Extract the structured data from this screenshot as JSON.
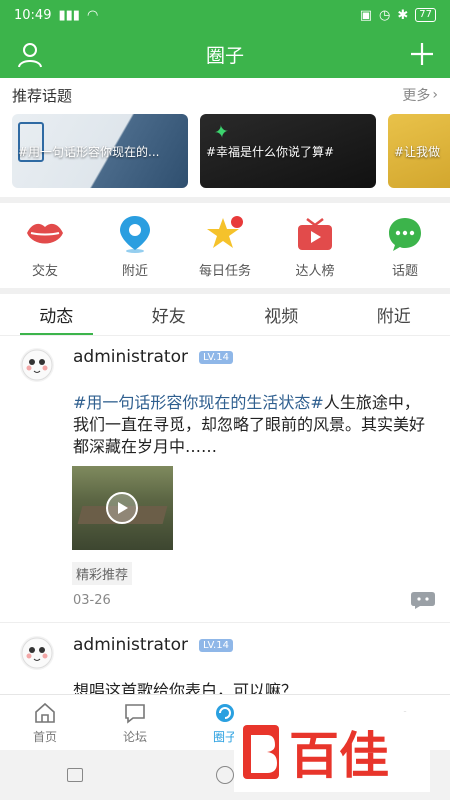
{
  "status_bar": {
    "time": "10:49",
    "battery": "77"
  },
  "app_bar": {
    "title": "圈子"
  },
  "topics": {
    "heading": "推荐话题",
    "more": "更多",
    "cards": [
      {
        "label": "#用一句话形容你现在的..."
      },
      {
        "label": "#幸福是什么你说了算#"
      },
      {
        "label": "#让我做"
      }
    ]
  },
  "quick": [
    {
      "label": "交友",
      "icon": "lips-icon"
    },
    {
      "label": "附近",
      "icon": "location-pin-icon"
    },
    {
      "label": "每日任务",
      "icon": "star-icon"
    },
    {
      "label": "达人榜",
      "icon": "tv-icon"
    },
    {
      "label": "话题",
      "icon": "chat-bubble-icon"
    }
  ],
  "tabs": [
    "动态",
    "好友",
    "视频",
    "附近"
  ],
  "posts": [
    {
      "username": "administrator",
      "level": "LV.14",
      "tag": "#用一句话形容你现在的生活状态#",
      "text": "人生旅途中，我们一直在寻觅，却忽略了眼前的风景。其实美好都深藏在岁月中……",
      "chip": "精彩推荐",
      "date": "03-26"
    },
    {
      "username": "administrator",
      "level": "LV.14",
      "text": "想唱这首歌给你表白，可以嘛？"
    }
  ],
  "bottom_nav": [
    {
      "label": "首页",
      "icon": "home-icon"
    },
    {
      "label": "论坛",
      "icon": "forum-icon"
    },
    {
      "label": "圈子",
      "icon": "circle-icon"
    },
    {
      "label": "",
      "icon": "message-icon"
    },
    {
      "label": "",
      "icon": "profile-icon"
    }
  ],
  "watermark": {
    "text": "百佳"
  },
  "colors": {
    "primary": "#3cb44b",
    "accent_blue": "#2aa0e0",
    "tag": "#2f5f8f"
  }
}
